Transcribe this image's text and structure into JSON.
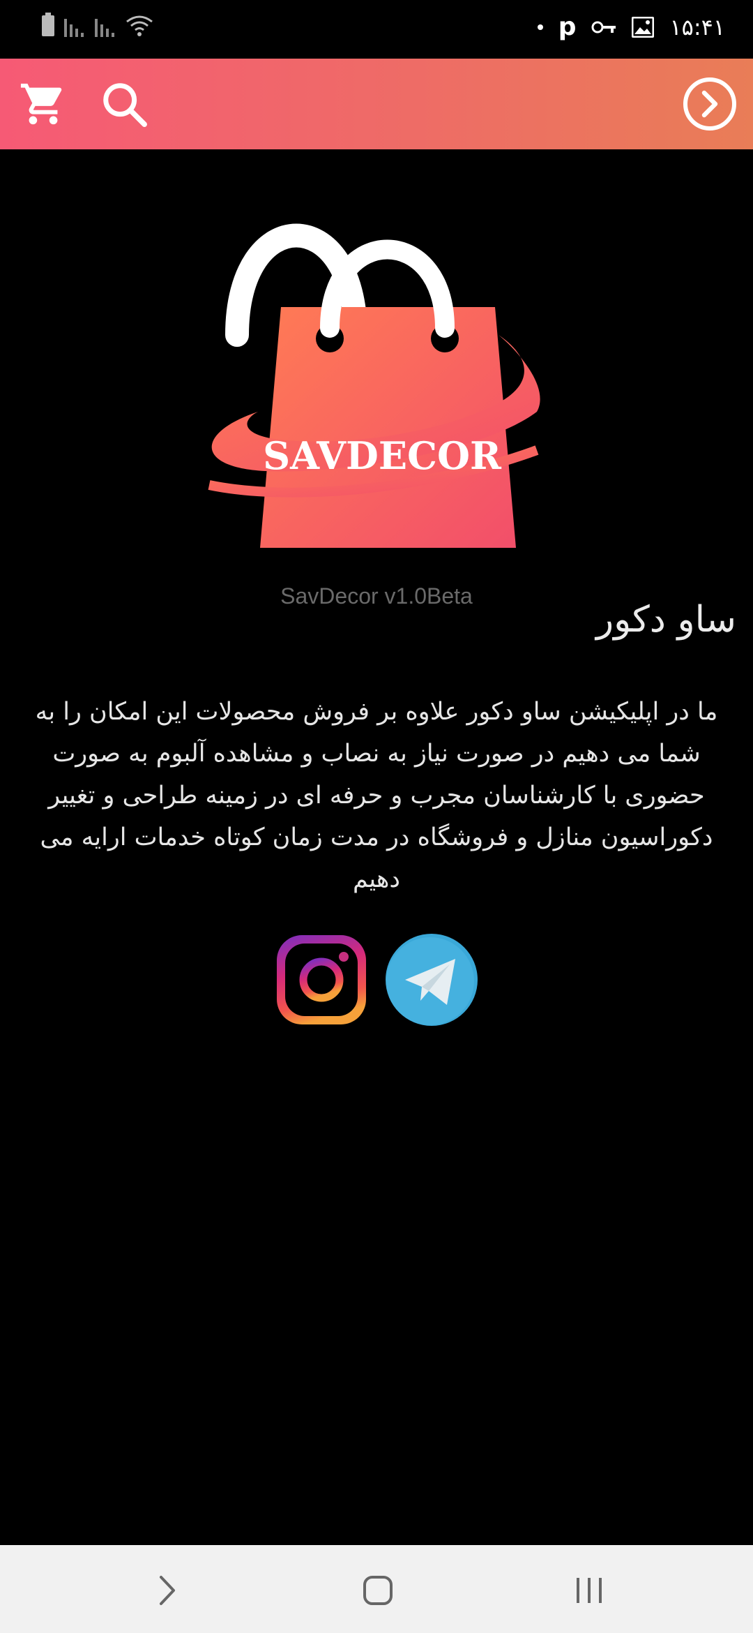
{
  "status_bar": {
    "time": "۱۵:۴۱",
    "notification_letter": "p",
    "icons": [
      "battery-icon",
      "signal-icon",
      "signal-icon",
      "wifi-icon",
      "dot-icon",
      "key-icon",
      "image-icon"
    ]
  },
  "app_bar": {
    "icons": [
      "cart-icon",
      "search-icon",
      "forward-circle-icon"
    ],
    "gradient": [
      "#f65a75",
      "#e97d57"
    ]
  },
  "logo": {
    "text": "SAVDECOR",
    "colors": [
      "#ff7a55",
      "#f24f6a"
    ]
  },
  "version": "SavDecor v1.0Beta",
  "title": "ساو دکور",
  "description": "ما در اپلیکیشن ساو دکور علاوه بر فروش محصولات این امکان را به شما می دهیم در صورت نیاز به نصاب و مشاهده آلبوم به صورت حضوری با کارشناسان مجرب و حرفه ای در زمینه طراحی و تغییر دکوراسیون منازل و فروشگاه در مدت زمان کوتاه خدمات ارایه می دهیم",
  "socials": [
    "instagram-icon",
    "telegram-icon"
  ],
  "nav_bar": {
    "icons": [
      "back-icon",
      "home-icon",
      "recents-icon"
    ]
  }
}
